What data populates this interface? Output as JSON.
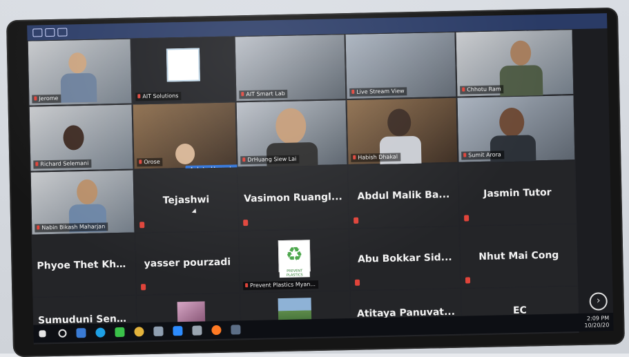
{
  "meeting": {
    "tiles_video": [
      {
        "name": "Jerome"
      },
      {
        "name": "AIT Solutions"
      },
      {
        "name": "AIT Smart Lab"
      },
      {
        "name": "Live Stream View"
      },
      {
        "name": "Chhotu Ram"
      },
      {
        "name": "Richard Selemani"
      },
      {
        "name": "Orose"
      },
      {
        "name": "DrHuang Siew Lai"
      },
      {
        "name": "Habish Dhakal"
      },
      {
        "name": "Sumit Arora"
      },
      {
        "name": "Nabin Bikash Maharjan"
      },
      {
        "name": "Prevent Plastics Myan..."
      }
    ],
    "tiles_names": [
      {
        "name": "Tejashwi"
      },
      {
        "name": "Vasimon Ruangl..."
      },
      {
        "name": "Abdul Malik Ba..."
      },
      {
        "name": "Jasmin Tutor"
      },
      {
        "name": "Phyoe Thet Khai..."
      },
      {
        "name": "yasser pourzadi"
      },
      {
        "name": "Abu Bokkar Sid..."
      },
      {
        "name": "Nhut Mai Cong"
      },
      {
        "name": "Sumuduni Sene..."
      },
      {
        "name": "Atitaya Panuvat..."
      },
      {
        "name": "EC"
      }
    ],
    "ask_to_unmute": "Ask to Unmute",
    "more": "...",
    "recycle_caption": "PREVENT PLASTICS"
  },
  "taskbar": {
    "time": "2:09 PM",
    "date": "10/20/20"
  },
  "icons": {
    "next_page": "chevron-right-icon",
    "mute": "mic-off-icon"
  },
  "colors": {
    "zoom_blue": "#2d72d9",
    "mute_red": "#e0443a"
  }
}
